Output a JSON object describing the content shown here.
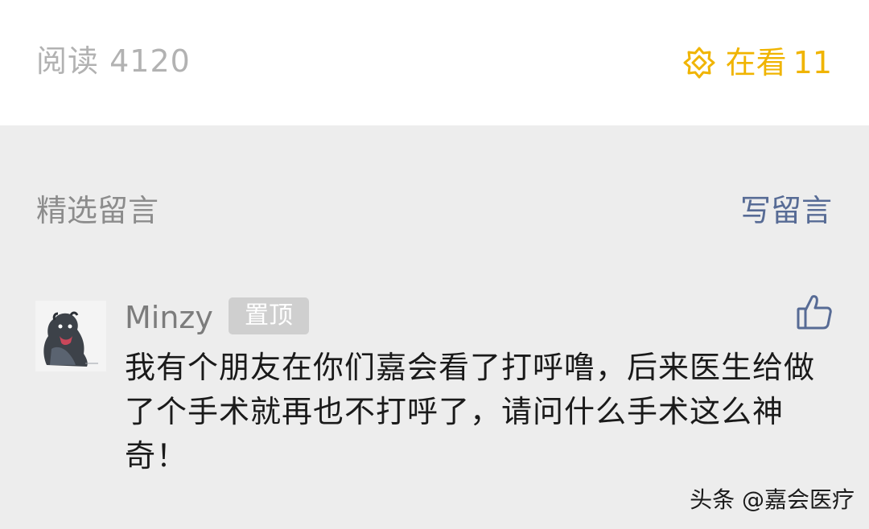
{
  "stats": {
    "read_label": "阅读",
    "read_count": "4120",
    "watching_label": "在看",
    "watching_count": "11",
    "watching_icon": "wow-icon",
    "watching_color": "#f0b400"
  },
  "comments_section": {
    "title": "精选留言",
    "write_label": "写留言",
    "write_color": "#576b95"
  },
  "comments": [
    {
      "nickname": "Minzy",
      "badge": "置顶",
      "text": "我有个朋友在你们嘉会看了打呼噜，后来医生给做了个手术就再也不打呼了，请问什么手术这么神奇！",
      "like_icon": "thumbs-up-icon"
    }
  ],
  "watermark": "头条 @嘉会医疗"
}
